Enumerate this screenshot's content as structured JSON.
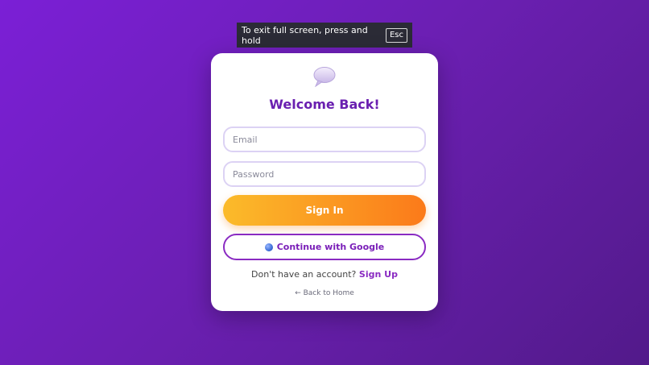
{
  "fullscreen_notice": {
    "text": "To exit full screen, press and hold",
    "key": "Esc"
  },
  "login": {
    "logo_icon": "speech-bubble-icon",
    "title": "Welcome Back!",
    "email_placeholder": "Email",
    "password_placeholder": "Password",
    "signin_label": "Sign In",
    "google_label": "Continue with Google",
    "google_icon": "google-icon",
    "signup_prompt": "Don't have an account?",
    "signup_link": "Sign Up",
    "back_link": "← Back to Home"
  },
  "colors": {
    "accent": "#6a1fb0",
    "button_gradient_start": "#fbbb2a",
    "button_gradient_end": "#fb7a1a",
    "link": "#8a2bc2"
  }
}
